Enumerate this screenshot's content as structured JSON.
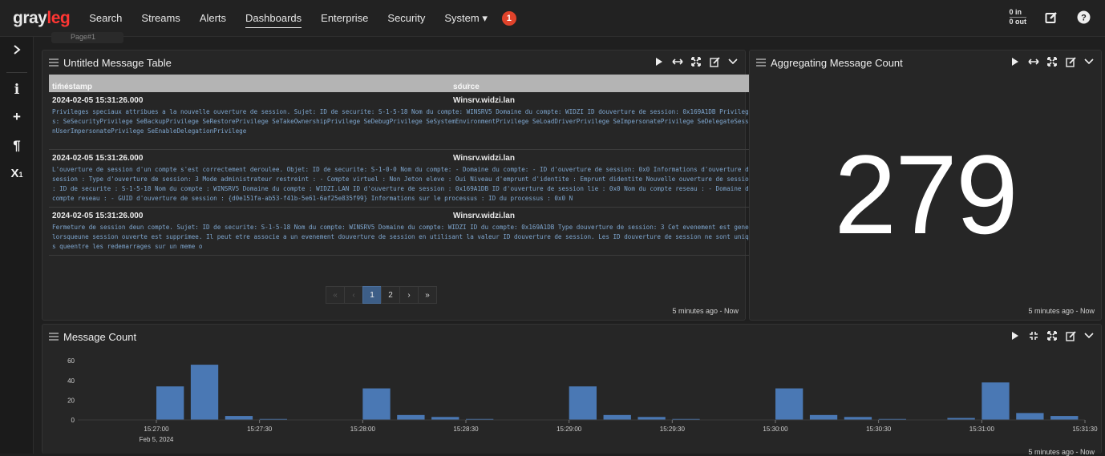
{
  "nav": {
    "logo_main": "gray",
    "logo_accent": "leg",
    "items": [
      {
        "label": "Search",
        "active": false
      },
      {
        "label": "Streams",
        "active": false
      },
      {
        "label": "Alerts",
        "active": false
      },
      {
        "label": "Dashboards",
        "active": true
      },
      {
        "label": "Enterprise",
        "active": false
      },
      {
        "label": "Security",
        "active": false
      },
      {
        "label": "System ▾",
        "active": false
      }
    ],
    "notification_count": "1",
    "throughput_in": "0 in",
    "throughput_out": "0 out",
    "edit_icon": "edit-icon",
    "help_icon": "help-icon"
  },
  "rail": {
    "expand_icon": "chevron-right-icon",
    "items": [
      {
        "icon": "info-icon",
        "glyph": "i"
      },
      {
        "icon": "plus-icon",
        "glyph": "+"
      },
      {
        "icon": "paragraph-icon",
        "glyph": "¶"
      },
      {
        "icon": "subscript-icon",
        "glyph": "X₁"
      }
    ]
  },
  "page_tab": "Page#1",
  "message_table": {
    "title": "Untitled Message Table",
    "columns": [
      "timestamp",
      "source"
    ],
    "rows": [
      {
        "timestamp": "2024-02-05 15:31:26.000",
        "source": "Winsrv.widzi.lan",
        "message": "Privileges speciaux attribues a la nouvelle ouverture de session. Sujet: ID de securite: S-1-5-18 Nom du compte: WINSRV5 Domaine du compte: WIDZI ID douverture de session: 0x169A1DB Privileges: SeSecurityPrivilege SeBackupPrivilege SeRestorePrivilege SeTakeOwnershipPrivilege SeDebugPrivilege SeSystemEnvironmentPrivilege SeLoadDriverPrivilege SeImpersonatePrivilege SeDelegateSessionUserImpersonatePrivilege SeEnableDelegationPrivilege"
      },
      {
        "timestamp": "2024-02-05 15:31:26.000",
        "source": "Winsrv.widzi.lan",
        "message": "L'ouverture de session d'un compte s'est correctement deroulee. Objet: ID de securite: S-1-0-0 Nom du compte: - Domaine du compte: - ID d'ouverture de session: 0x0 Informations d'ouverture de session : Type d'ouverture de session: 3 Mode administrateur restreint : - Compte virtuel : Non Jeton eleve : Oui Niveau d'emprunt d'identite : Emprunt didentite Nouvelle ouverture de session : ID de securite : S-1-5-18 Nom du compte : WINSRV5 Domaine du compte : WIDZI.LAN ID d'ouverture de session : 0x169A1DB ID d'ouverture de session lie : 0x0 Nom du compte reseau : - Domaine du compte reseau : - GUID d'ouverture de session : {d0e151fa-ab53-f41b-5e61-6af25e835f99} Informations sur le processus : ID du processus : 0x0 N"
      },
      {
        "timestamp": "2024-02-05 15:31:26.000",
        "source": "Winsrv.widzi.lan",
        "message": "Fermeture de session deun compte. Sujet: ID de securite: S-1-5-18 Nom du compte: WINSRV5 Domaine du compte: WIDZI ID du compte: 0x169A1DB Type douverture de session: 3 Cet evenement est genere lorsqueune session ouverte est supprimee. Il peut etre associe a un evenement douverture de session en utilisant la valeur ID douverture de session. Les ID douverture de session ne sont uniques queentre les redemarrages sur un meme o"
      }
    ],
    "pager": {
      "first": "«",
      "prev": "‹",
      "pages": [
        "1",
        "2"
      ],
      "next": "›",
      "last": "»",
      "current": "1"
    },
    "footer": "5 minutes ago - Now"
  },
  "aggregate": {
    "title": "Aggregating Message Count",
    "value": "279",
    "footer": "5 minutes ago - Now"
  },
  "message_count": {
    "title": "Message Count",
    "footer": "5 minutes ago - Now",
    "date_label": "Feb 5, 2024"
  },
  "colors": {
    "bar": "#4a78b4",
    "accent": "#ff3633",
    "pager_active": "#3d5e87"
  },
  "chart_data": {
    "type": "bar",
    "title": "Message Count",
    "xlabel": "",
    "ylabel": "",
    "ylim": [
      0,
      65
    ],
    "yticks": [
      0,
      20,
      40,
      60
    ],
    "x_tick_labels": [
      "15:27:00",
      "15:27:30",
      "15:28:00",
      "15:28:30",
      "15:29:00",
      "15:29:30",
      "15:30:00",
      "15:30:30",
      "15:31:00",
      "15:31:30"
    ],
    "x_start_seconds": 0,
    "x_end_seconds": 270,
    "bar_width_seconds": 10,
    "bars": [
      {
        "t": "15:27:00",
        "value": 34
      },
      {
        "t": "15:27:10",
        "value": 56
      },
      {
        "t": "15:27:20",
        "value": 4
      },
      {
        "t": "15:27:30",
        "value": 1
      },
      {
        "t": "15:28:00",
        "value": 32
      },
      {
        "t": "15:28:10",
        "value": 5
      },
      {
        "t": "15:28:20",
        "value": 3
      },
      {
        "t": "15:28:30",
        "value": 1
      },
      {
        "t": "15:29:00",
        "value": 34
      },
      {
        "t": "15:29:10",
        "value": 5
      },
      {
        "t": "15:29:20",
        "value": 3
      },
      {
        "t": "15:29:30",
        "value": 1
      },
      {
        "t": "15:30:00",
        "value": 32
      },
      {
        "t": "15:30:10",
        "value": 5
      },
      {
        "t": "15:30:20",
        "value": 3
      },
      {
        "t": "15:30:30",
        "value": 1
      },
      {
        "t": "15:30:50",
        "value": 2
      },
      {
        "t": "15:31:00",
        "value": 38
      },
      {
        "t": "15:31:10",
        "value": 7
      },
      {
        "t": "15:31:20",
        "value": 4
      }
    ],
    "grid": false,
    "legend": "none"
  }
}
